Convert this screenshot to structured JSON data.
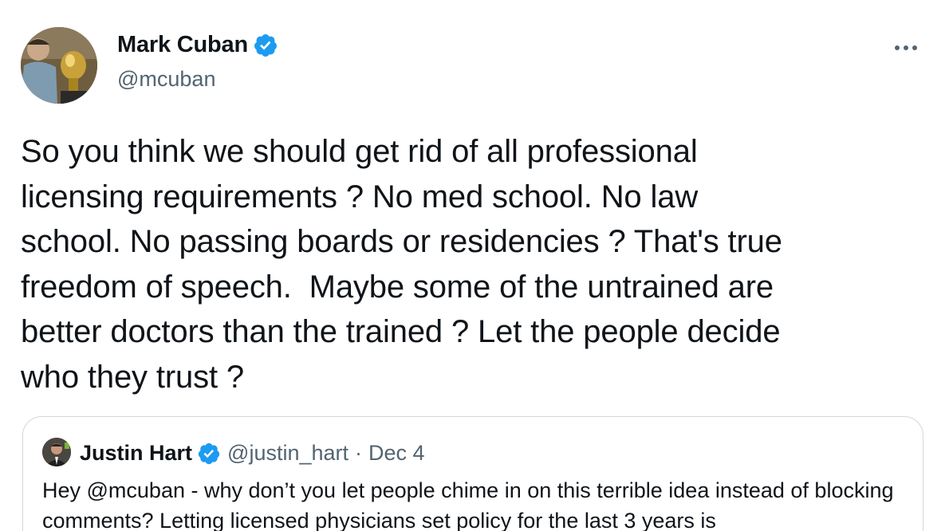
{
  "author": {
    "name": "Mark Cuban",
    "handle": "@mcuban"
  },
  "tweet": {
    "text": "So you think we should get rid of all professional\nlicensing requirements ? No med school. No law\nschool. No passing boards or residencies ? That's true\nfreedom of speech.  Maybe some of the untrained are\nbetter doctors than the trained ? Let the people decide\nwho they trust ?"
  },
  "quoted": {
    "name": "Justin Hart",
    "handle": "@justin_hart",
    "separator": "·",
    "date": "Dec 4",
    "text": "Hey @mcuban - why don’t you let people chime in on this terrible idea instead of blocking comments? Letting licensed physicians set policy for the last 3 years is"
  },
  "icons": {
    "verified": "verified-badge-icon",
    "more": "more-options-icon"
  },
  "colors": {
    "verified": "#1d9bf0",
    "secondary_text": "#536471",
    "border": "#cfd9de"
  }
}
